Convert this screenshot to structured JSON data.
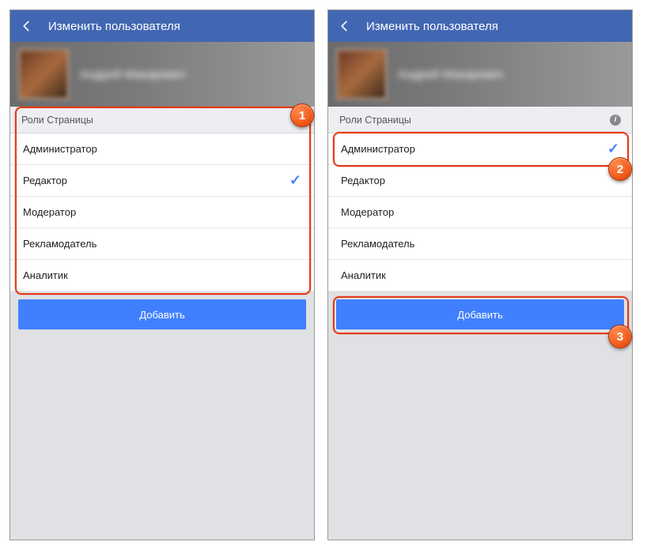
{
  "header": {
    "title": "Изменить пользователя"
  },
  "profile": {
    "name": "Андрей Макаревич"
  },
  "section": {
    "title": "Роли Страницы"
  },
  "roles": [
    {
      "label": "Администратор"
    },
    {
      "label": "Редактор"
    },
    {
      "label": "Модератор"
    },
    {
      "label": "Рекламодатель"
    },
    {
      "label": "Аналитик"
    }
  ],
  "left": {
    "selected_index": 1
  },
  "right": {
    "selected_index": 0
  },
  "button": {
    "add": "Добавить"
  },
  "callouts": {
    "c1": "1",
    "c2": "2",
    "c3": "3"
  }
}
